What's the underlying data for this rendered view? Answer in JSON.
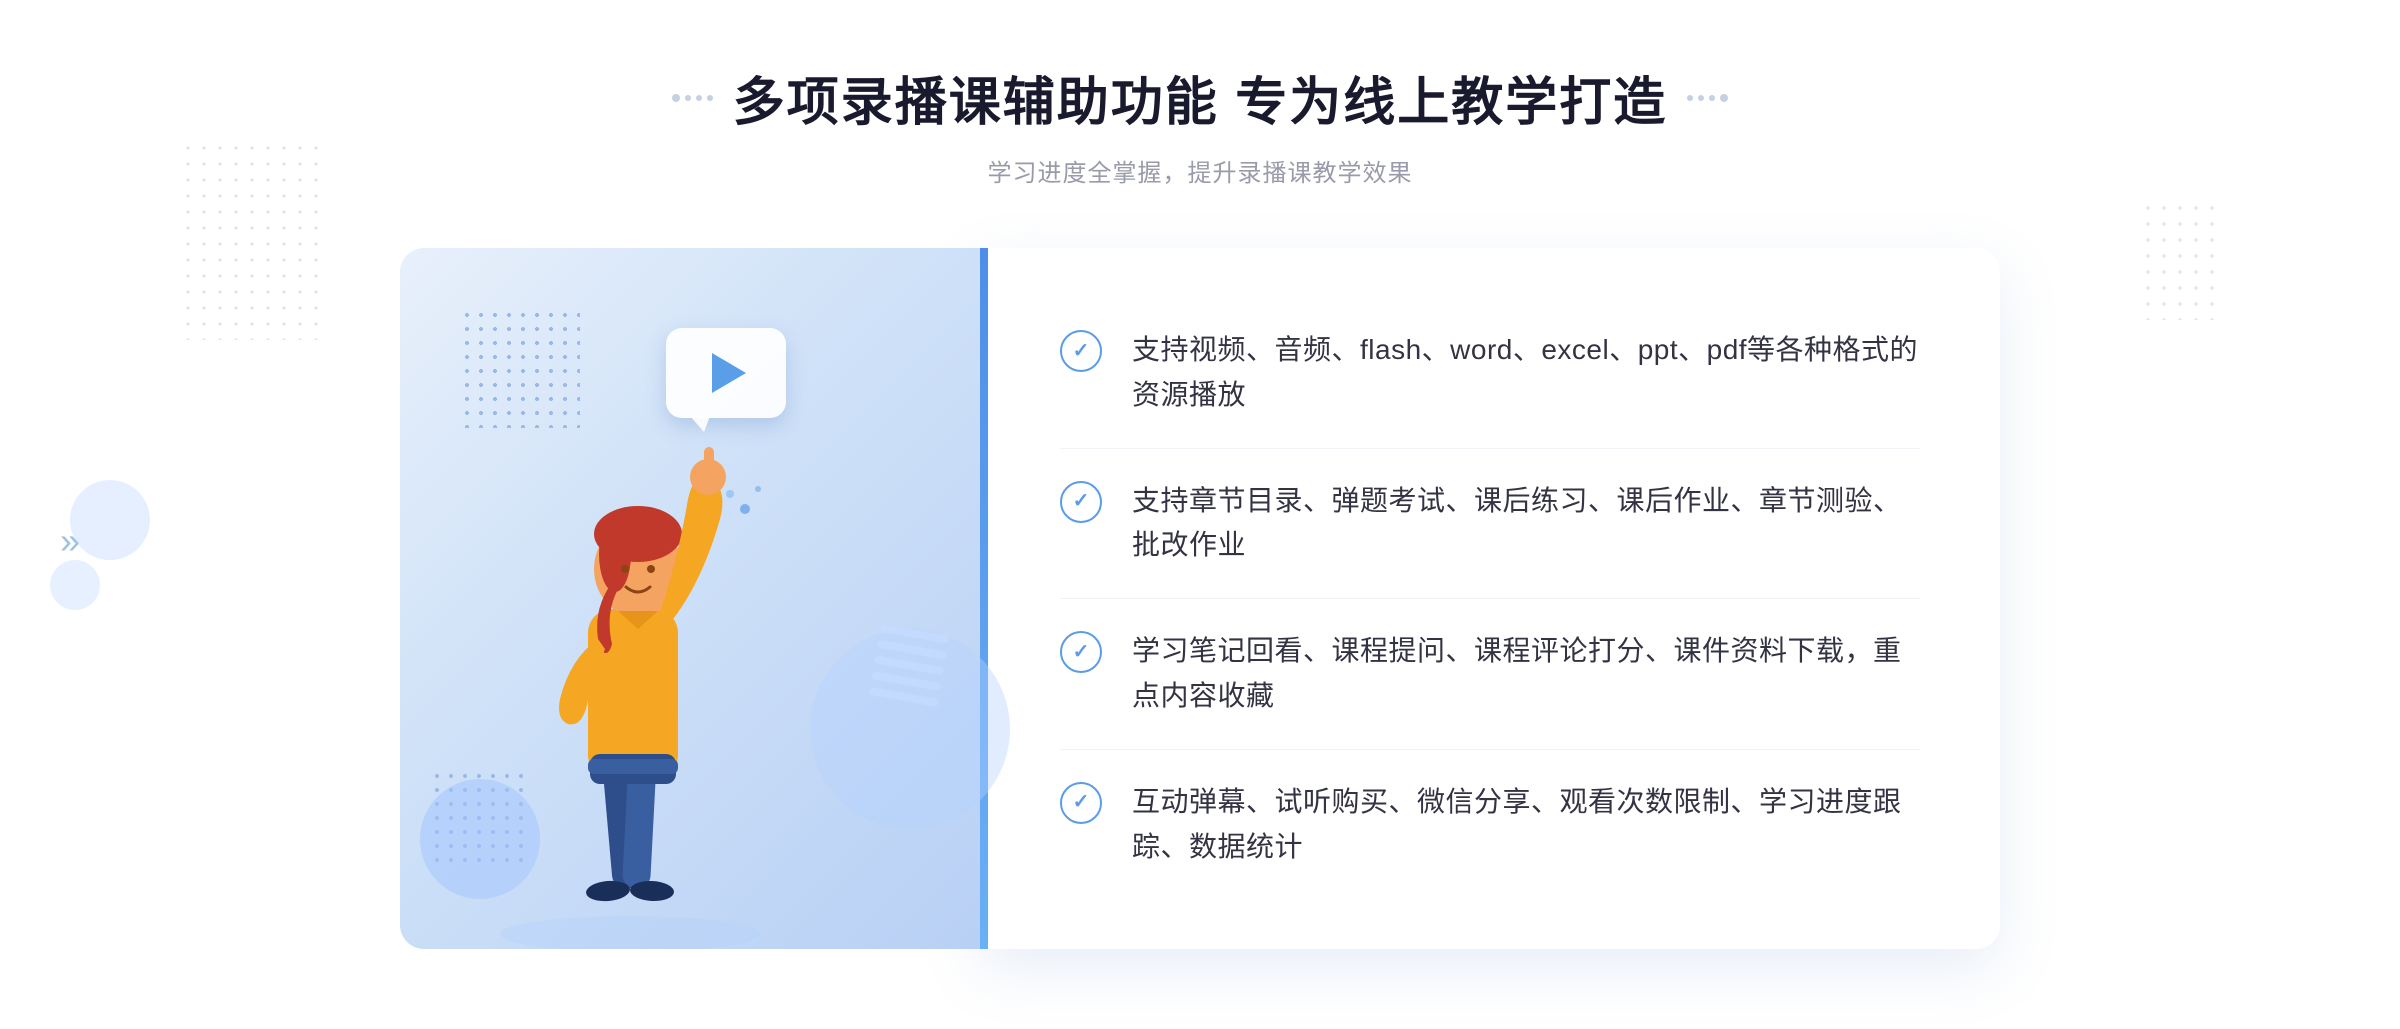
{
  "header": {
    "title": "多项录播课辅助功能 专为线上教学打造",
    "subtitle": "学习进度全掌握，提升录播课教学效果",
    "left_decorator_dots": [
      "·",
      "·",
      "·",
      "·"
    ],
    "right_decorator_dots": [
      "·",
      "·",
      "·",
      "·"
    ]
  },
  "features": [
    {
      "id": 1,
      "text": "支持视频、音频、flash、word、excel、ppt、pdf等各种格式的资源播放"
    },
    {
      "id": 2,
      "text": "支持章节目录、弹题考试、课后练习、课后作业、章节测验、批改作业"
    },
    {
      "id": 3,
      "text": "学习笔记回看、课程提问、课程评论打分、课件资料下载，重点内容收藏"
    },
    {
      "id": 4,
      "text": "互动弹幕、试听购买、微信分享、观看次数限制、学习进度跟踪、数据统计"
    }
  ],
  "icons": {
    "check": "✓",
    "play": "▶",
    "chevron_left": "»",
    "chevron_right": "»"
  },
  "colors": {
    "primary_blue": "#4d8ee8",
    "light_blue": "#b8d5f8",
    "text_dark": "#333344",
    "text_gray": "#999aaa",
    "title_color": "#1a1a2e",
    "bg_panel": "#e8f0fb",
    "accent_bar": "#5b9be8"
  }
}
